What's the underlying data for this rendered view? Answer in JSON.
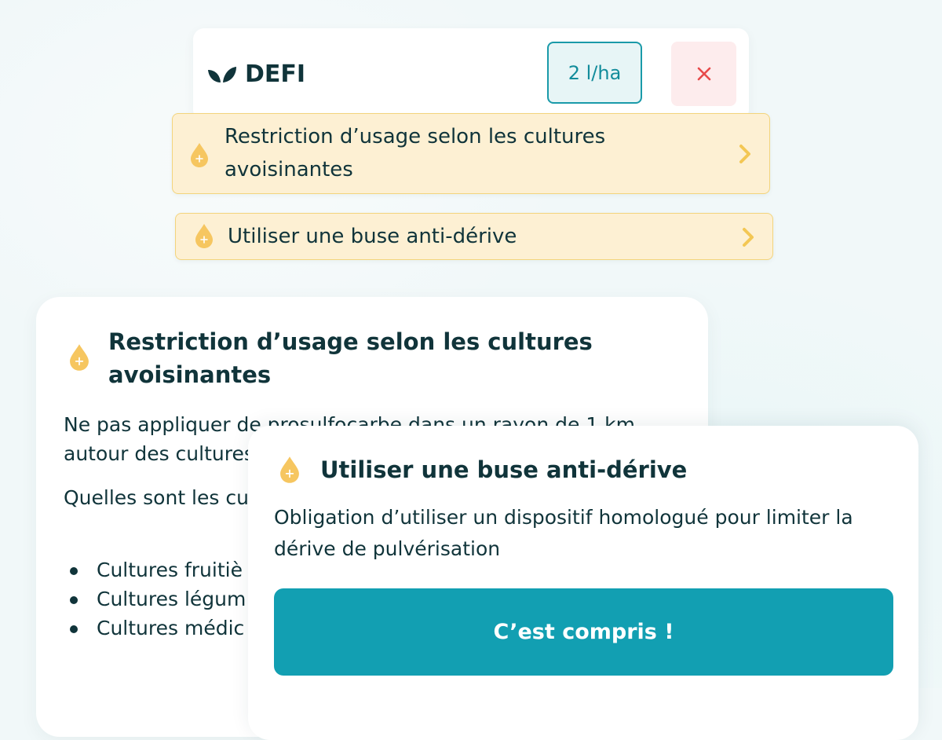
{
  "product": {
    "name": "DEFI",
    "dose": "2 l/ha",
    "icon": "leaf-icon",
    "remove_icon": "close-icon"
  },
  "warnings": [
    {
      "label": "Restriction d’usage selon les cultures avoisinantes",
      "icon": "drop-icon"
    },
    {
      "label": "Utiliser une buse anti-dérive",
      "icon": "drop-icon"
    }
  ],
  "sheet_restriction": {
    "title": "Restriction d’usage selon les cultures avoisinantes",
    "paragraph_1": "Ne pas appliquer de prosulfocarbe dans un rayon de 1 km autour des cultures",
    "paragraph_2": "Quelles sont les cu applications d’auto",
    "list": [
      "Cultures fruitiè",
      "Cultures légum fontaines, roqu",
      "Cultures médic"
    ]
  },
  "sheet_drift": {
    "title": "Utiliser une buse anti-dérive",
    "description": "Obligation d’utiliser un dispositif homologué pour limiter la dérive de pulvérisation",
    "confirm_label": "C’est compris !"
  },
  "colors": {
    "teal": "#129fb2",
    "dark_text": "#10343a",
    "warning_bg": "#fdf0d3",
    "warning_border": "#f3d47c",
    "drop_yellow": "#f6c660",
    "remove_bg": "#fdeced",
    "remove_icon": "#e84a4a"
  }
}
